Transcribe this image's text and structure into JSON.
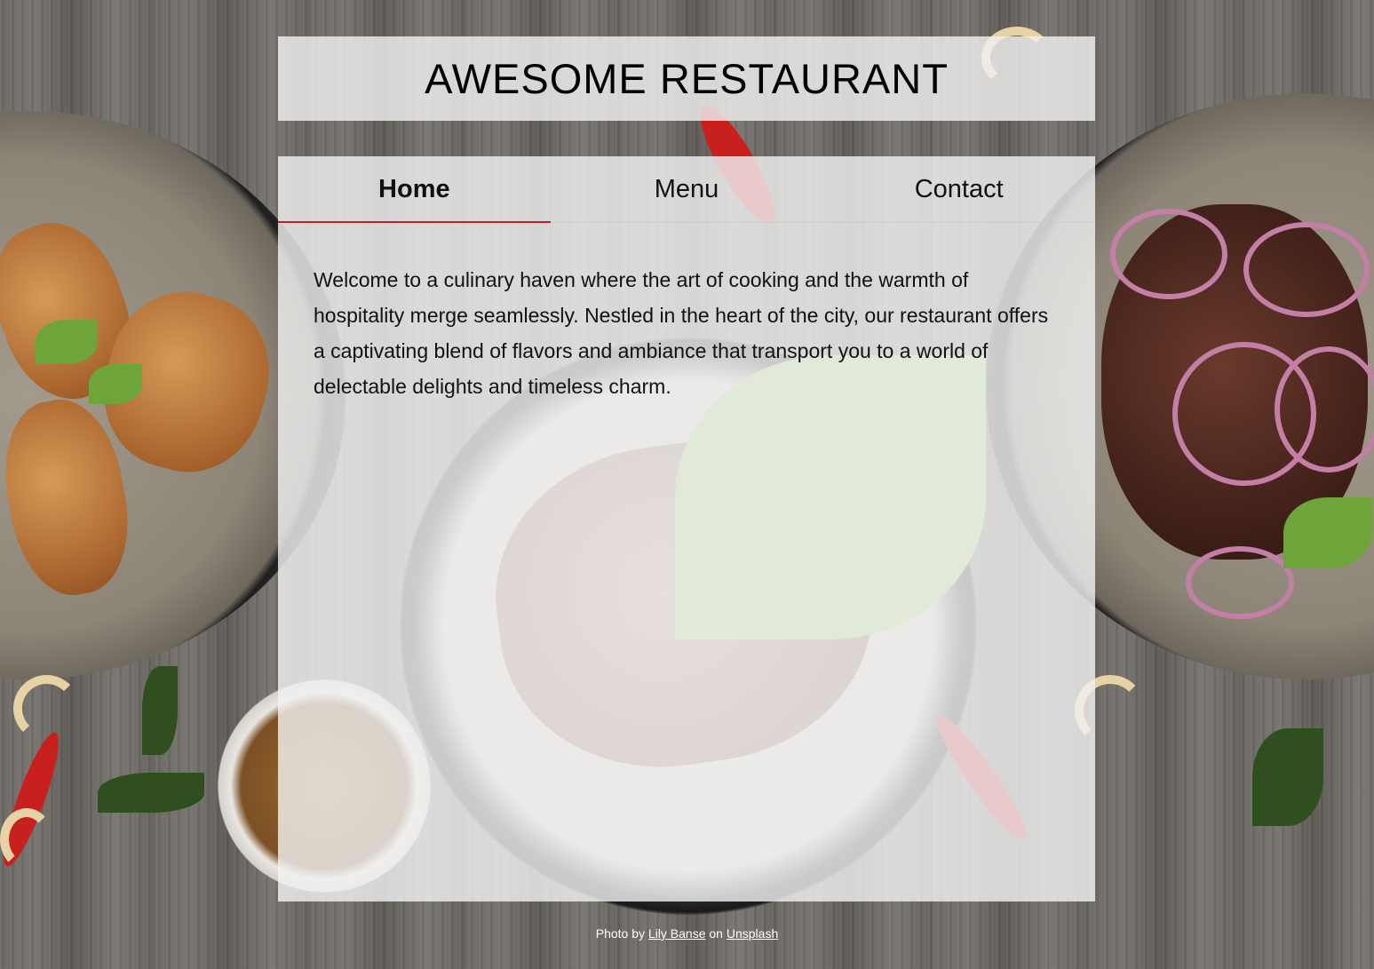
{
  "header": {
    "title": "AWESOME RESTAURANT"
  },
  "nav": {
    "tabs": [
      {
        "label": "Home",
        "active": true
      },
      {
        "label": "Menu",
        "active": false
      },
      {
        "label": "Contact",
        "active": false
      }
    ]
  },
  "main": {
    "intro": "Welcome to a culinary haven where the art of cooking and the warmth of hospitality merge seamlessly. Nestled in the heart of the city, our restaurant offers a captivating blend of flavors and ambiance that transport you to a world of delectable delights and timeless charm."
  },
  "footer": {
    "prefix": "Photo by ",
    "photographer": "Lily Banse",
    "middle": " on ",
    "source": "Unsplash"
  },
  "colors": {
    "active_tab_underline": "#c4202a",
    "panel_background": "rgba(240,240,240,0.82)"
  }
}
